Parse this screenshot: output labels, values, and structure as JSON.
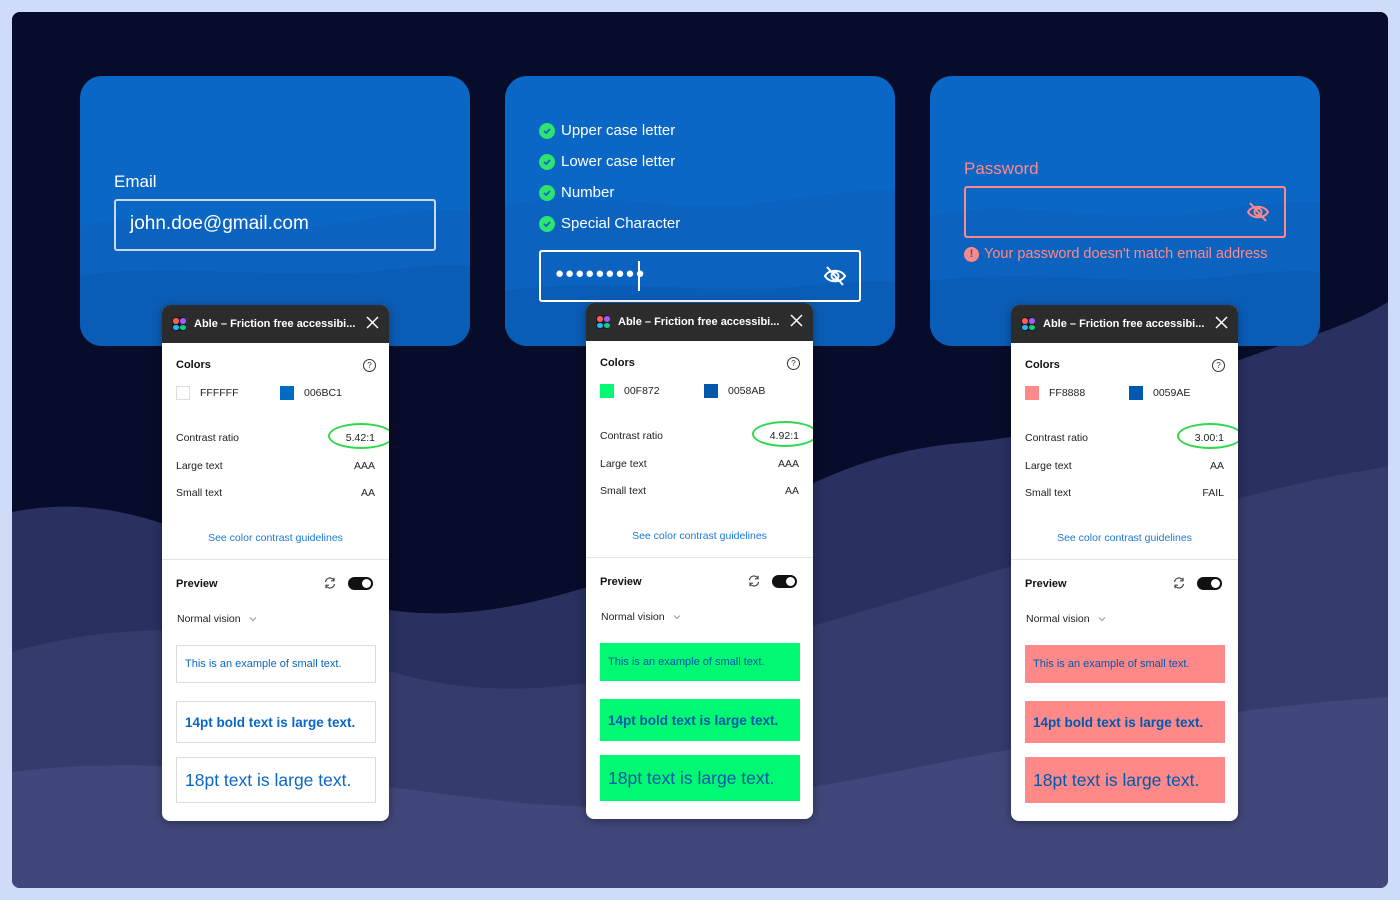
{
  "cards": {
    "email": {
      "label": "Email",
      "value": "john.doe@gmail.com"
    },
    "password_rules": {
      "rules": [
        "Upper case letter",
        "Lower case letter",
        "Number",
        "Special Character"
      ],
      "masked_value": "●●●●●●●●●"
    },
    "password_error": {
      "label": "Password",
      "error": "Your password doesn't match email address",
      "accent": "#ff8888"
    }
  },
  "panels": [
    {
      "title": "Able – Friction free accessibi...",
      "colors_title": "Colors",
      "fg": {
        "hex": "FFFFFF",
        "color": "#ffffff"
      },
      "bg": {
        "hex": "006BC1",
        "color": "#006bc1"
      },
      "contrast_label": "Contrast ratio",
      "contrast_value": "5.42:1",
      "large_label": "Large text",
      "large_value": "AAA",
      "small_label": "Small text",
      "small_value": "AA",
      "guidelines": "See color contrast guidelines",
      "preview_title": "Preview",
      "vision": "Normal vision",
      "examples": [
        "This is an example of small text.",
        "14pt bold text is large text.",
        "18pt text is large text."
      ],
      "example_bg": "#ffffff"
    },
    {
      "title": "Able – Friction free accessibi...",
      "colors_title": "Colors",
      "fg": {
        "hex": "00F872",
        "color": "#00f872"
      },
      "bg": {
        "hex": "0058AB",
        "color": "#0058ab"
      },
      "contrast_label": "Contrast ratio",
      "contrast_value": "4.92:1",
      "large_label": "Large text",
      "large_value": "AAA",
      "small_label": "Small text",
      "small_value": "AA",
      "guidelines": "See color contrast guidelines",
      "preview_title": "Preview",
      "vision": "Normal vision",
      "examples": [
        "This is an example of small text.",
        "14pt bold text is large text.",
        "18pt text is large text."
      ],
      "example_bg": "#00f872"
    },
    {
      "title": "Able – Friction free accessibi...",
      "colors_title": "Colors",
      "fg": {
        "hex": "FF8888",
        "color": "#ff8888"
      },
      "bg": {
        "hex": "0059AE",
        "color": "#0059ae"
      },
      "contrast_label": "Contrast ratio",
      "contrast_value": "3.00:1",
      "large_label": "Large text",
      "large_value": "AA",
      "small_label": "Small text",
      "small_value": "FAIL",
      "guidelines": "See color contrast guidelines",
      "preview_title": "Preview",
      "vision": "Normal vision",
      "examples": [
        "This is an example of small text.",
        "14pt bold text is large text.",
        "18pt text is large text."
      ],
      "example_bg": "#ff8888"
    }
  ],
  "icons": {
    "check": "check-circle-icon",
    "eye_off": "eye-off-icon",
    "error": "error-icon",
    "close": "close-icon",
    "help": "help-icon",
    "refresh": "refresh-icon",
    "chevron": "chevron-down-icon"
  }
}
